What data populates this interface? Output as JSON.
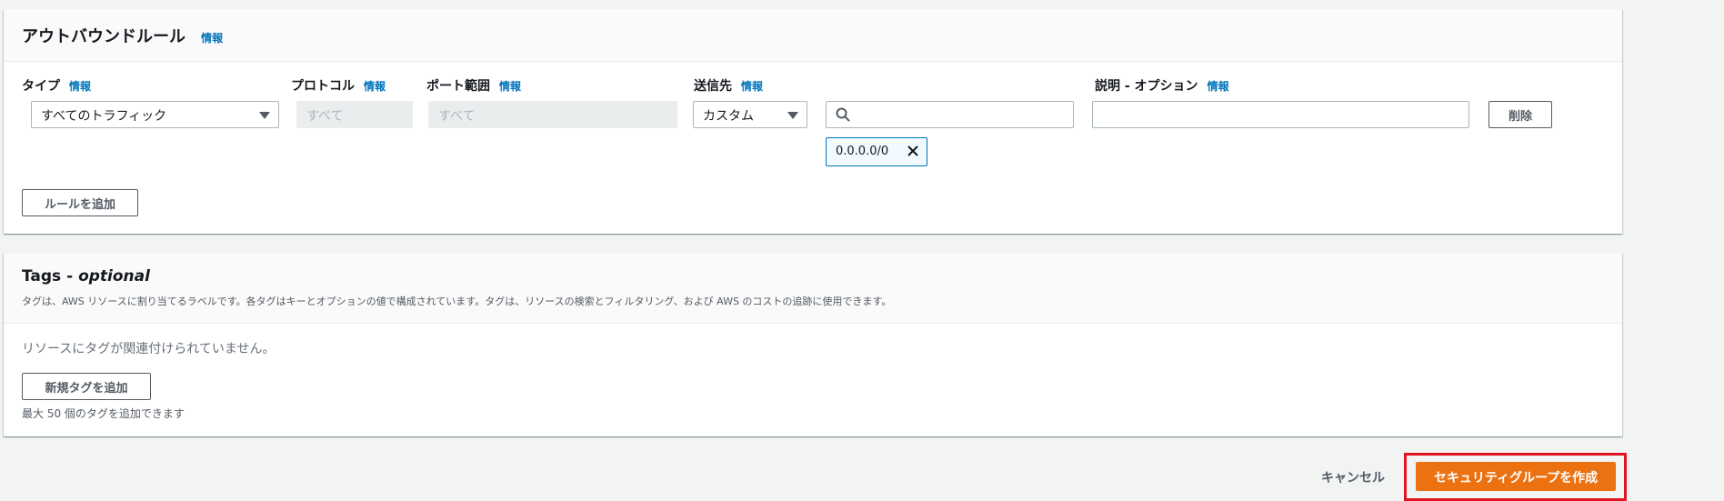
{
  "outbound": {
    "title": "アウトバウンドルール",
    "info": "情報",
    "columns": {
      "type": "タイプ",
      "protocol": "プロトコル",
      "port_range": "ポート範囲",
      "destination": "送信先",
      "description": "説明 - オプション"
    },
    "rule": {
      "type_value": "すべてのトラフィック",
      "protocol_value": "すべて",
      "port_value": "すべて",
      "destination_value": "カスタム",
      "search_value": "",
      "description_value": "",
      "cidr_token": "0.0.0.0/0",
      "delete_label": "削除"
    },
    "add_rule_label": "ルールを追加"
  },
  "tags": {
    "title": "Tags - ",
    "title_italic": "optional",
    "description": "タグは、AWS リソースに割り当てるラベルです。各タグはキーとオプションの値で構成されています。タグは、リソースの検索とフィルタリング、および AWS のコストの追跡に使用できます。",
    "empty_text": "リソースにタグが関連付けられていません。",
    "add_tag_label": "新規タグを追加",
    "limit_text": "最大 50 個のタグを追加できます"
  },
  "footer": {
    "cancel_label": "キャンセル",
    "create_label": "セキュリティグループを作成"
  },
  "colors": {
    "primary": "#ec7211",
    "link": "#0073bb",
    "highlight": "#e0151f"
  }
}
